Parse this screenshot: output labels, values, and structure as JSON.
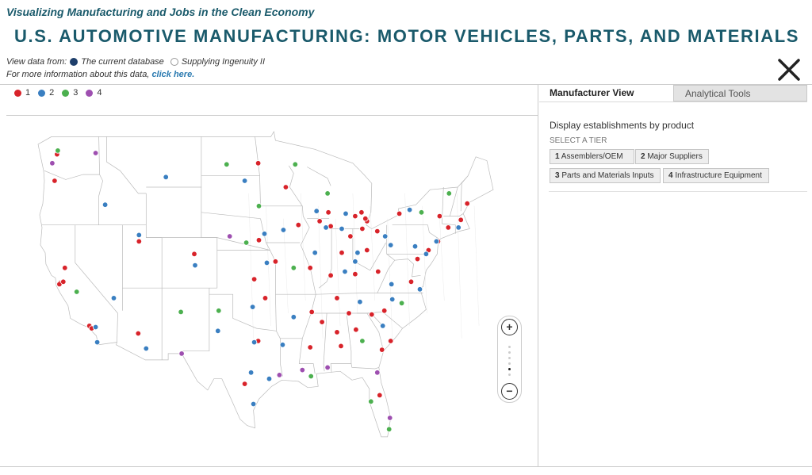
{
  "header": {
    "subtitle": "Visualizing Manufacturing and Jobs in the Clean Economy",
    "title": "U.S. AUTOMOTIVE MANUFACTURING: MOTOR VEHICLES, PARTS, AND MATERIALS"
  },
  "data_source": {
    "prefix": "View data from:",
    "options": [
      {
        "label": "The current database",
        "selected": true
      },
      {
        "label": "Supplying Ingenuity II",
        "selected": false
      }
    ],
    "info_text": "For more information about this data,",
    "info_link": "click here."
  },
  "close_icon": "close-x-icon",
  "legend": [
    {
      "label": "1",
      "color": "#d8232a"
    },
    {
      "label": "2",
      "color": "#3a7fc1"
    },
    {
      "label": "3",
      "color": "#4cb04f"
    },
    {
      "label": "4",
      "color": "#9e4fb0"
    }
  ],
  "tabs": [
    {
      "label": "Manufacturer View",
      "active": true
    },
    {
      "label": "Analytical Tools",
      "active": false
    }
  ],
  "panel": {
    "heading": "Display establishments by product",
    "tier_label": "SELECT A TIER",
    "tiers": [
      {
        "num": "1",
        "label": "Assemblers/OEM"
      },
      {
        "num": "2",
        "label": "Major Suppliers"
      },
      {
        "num": "3",
        "label": "Parts and Materials Inputs"
      },
      {
        "num": "4",
        "label": "Infrastructure Equipment"
      }
    ]
  },
  "zoom": {
    "in_label": "+",
    "out_label": "−",
    "level": 5,
    "levels": 6
  },
  "map": {
    "state_fill": "#ffffff",
    "state_stroke": "#bbbbbb",
    "markers": [
      {
        "lng": -122.6,
        "lat": 45.5,
        "tier": 1
      },
      {
        "lng": -122.3,
        "lat": 47.6,
        "tier": 1
      },
      {
        "lng": -122.2,
        "lat": 47.9,
        "tier": 3
      },
      {
        "lng": -122.9,
        "lat": 46.9,
        "tier": 4
      },
      {
        "lng": -117.4,
        "lat": 47.7,
        "tier": 4
      },
      {
        "lng": -116.2,
        "lat": 43.6,
        "tier": 2
      },
      {
        "lng": -121.9,
        "lat": 37.4,
        "tier": 1
      },
      {
        "lng": -122.0,
        "lat": 37.3,
        "tier": 1
      },
      {
        "lng": -121.5,
        "lat": 37.5,
        "tier": 1
      },
      {
        "lng": -121.3,
        "lat": 38.6,
        "tier": 1
      },
      {
        "lng": -119.8,
        "lat": 36.7,
        "tier": 3
      },
      {
        "lng": -118.2,
        "lat": 34.0,
        "tier": 1
      },
      {
        "lng": -117.9,
        "lat": 33.8,
        "tier": 1
      },
      {
        "lng": -117.4,
        "lat": 33.9,
        "tier": 2
      },
      {
        "lng": -117.2,
        "lat": 32.7,
        "tier": 2
      },
      {
        "lng": -115.1,
        "lat": 36.2,
        "tier": 2
      },
      {
        "lng": -111.9,
        "lat": 40.7,
        "tier": 1
      },
      {
        "lng": -111.9,
        "lat": 41.2,
        "tier": 2
      },
      {
        "lng": -112.0,
        "lat": 33.4,
        "tier": 1
      },
      {
        "lng": -111.0,
        "lat": 32.2,
        "tier": 2
      },
      {
        "lng": -104.9,
        "lat": 39.7,
        "tier": 1
      },
      {
        "lng": -104.8,
        "lat": 38.8,
        "tier": 2
      },
      {
        "lng": -106.6,
        "lat": 35.1,
        "tier": 3
      },
      {
        "lng": -106.5,
        "lat": 31.8,
        "tier": 4
      },
      {
        "lng": -108.5,
        "lat": 45.8,
        "tier": 2
      },
      {
        "lng": -100.8,
        "lat": 46.8,
        "tier": 3
      },
      {
        "lng": -96.8,
        "lat": 46.9,
        "tier": 1
      },
      {
        "lng": -98.5,
        "lat": 45.5,
        "tier": 2
      },
      {
        "lng": -96.7,
        "lat": 43.5,
        "tier": 3
      },
      {
        "lng": -96.0,
        "lat": 41.3,
        "tier": 2
      },
      {
        "lng": -96.7,
        "lat": 40.8,
        "tier": 1
      },
      {
        "lng": -98.3,
        "lat": 40.6,
        "tier": 3
      },
      {
        "lng": -100.4,
        "lat": 41.1,
        "tier": 4
      },
      {
        "lng": -97.3,
        "lat": 37.7,
        "tier": 1
      },
      {
        "lng": -95.7,
        "lat": 39.0,
        "tier": 2
      },
      {
        "lng": -94.6,
        "lat": 39.1,
        "tier": 1
      },
      {
        "lng": -97.5,
        "lat": 35.5,
        "tier": 2
      },
      {
        "lng": -95.9,
        "lat": 36.2,
        "tier": 1
      },
      {
        "lng": -96.8,
        "lat": 32.8,
        "tier": 1
      },
      {
        "lng": -97.3,
        "lat": 32.7,
        "tier": 2
      },
      {
        "lng": -97.7,
        "lat": 30.3,
        "tier": 2
      },
      {
        "lng": -98.5,
        "lat": 29.4,
        "tier": 1
      },
      {
        "lng": -95.4,
        "lat": 29.8,
        "tier": 2
      },
      {
        "lng": -94.1,
        "lat": 30.1,
        "tier": 4
      },
      {
        "lng": -101.8,
        "lat": 35.2,
        "tier": 3
      },
      {
        "lng": -101.9,
        "lat": 33.6,
        "tier": 2
      },
      {
        "lng": -97.4,
        "lat": 27.8,
        "tier": 2
      },
      {
        "lng": -93.3,
        "lat": 45.0,
        "tier": 1
      },
      {
        "lng": -92.1,
        "lat": 46.8,
        "tier": 3
      },
      {
        "lng": -93.6,
        "lat": 41.6,
        "tier": 2
      },
      {
        "lng": -91.7,
        "lat": 42.0,
        "tier": 1
      },
      {
        "lng": -90.2,
        "lat": 38.6,
        "tier": 1
      },
      {
        "lng": -92.3,
        "lat": 38.6,
        "tier": 3
      },
      {
        "lng": -92.3,
        "lat": 34.7,
        "tier": 2
      },
      {
        "lng": -91.2,
        "lat": 30.5,
        "tier": 4
      },
      {
        "lng": -90.1,
        "lat": 30.0,
        "tier": 3
      },
      {
        "lng": -93.7,
        "lat": 32.5,
        "tier": 2
      },
      {
        "lng": -87.9,
        "lat": 43.0,
        "tier": 1
      },
      {
        "lng": -89.4,
        "lat": 43.1,
        "tier": 2
      },
      {
        "lng": -88.0,
        "lat": 44.5,
        "tier": 3
      },
      {
        "lng": -87.6,
        "lat": 41.9,
        "tier": 1
      },
      {
        "lng": -88.2,
        "lat": 41.8,
        "tier": 2
      },
      {
        "lng": -89.6,
        "lat": 39.8,
        "tier": 2
      },
      {
        "lng": -89.0,
        "lat": 42.3,
        "tier": 1
      },
      {
        "lng": -83.0,
        "lat": 42.3,
        "tier": 1
      },
      {
        "lng": -83.2,
        "lat": 42.5,
        "tier": 1
      },
      {
        "lng": -84.5,
        "lat": 42.7,
        "tier": 1
      },
      {
        "lng": -85.7,
        "lat": 42.9,
        "tier": 2
      },
      {
        "lng": -83.7,
        "lat": 43.0,
        "tier": 1
      },
      {
        "lng": -86.2,
        "lat": 41.7,
        "tier": 2
      },
      {
        "lng": -85.1,
        "lat": 41.1,
        "tier": 1
      },
      {
        "lng": -86.2,
        "lat": 39.8,
        "tier": 1
      },
      {
        "lng": -87.6,
        "lat": 38.0,
        "tier": 1
      },
      {
        "lng": -85.8,
        "lat": 38.3,
        "tier": 2
      },
      {
        "lng": -84.5,
        "lat": 38.1,
        "tier": 1
      },
      {
        "lng": -84.5,
        "lat": 39.1,
        "tier": 2
      },
      {
        "lng": -83.0,
        "lat": 40.0,
        "tier": 1
      },
      {
        "lng": -81.7,
        "lat": 41.5,
        "tier": 1
      },
      {
        "lng": -83.6,
        "lat": 41.7,
        "tier": 1
      },
      {
        "lng": -80.7,
        "lat": 41.1,
        "tier": 2
      },
      {
        "lng": -84.2,
        "lat": 39.8,
        "tier": 2
      },
      {
        "lng": -80.0,
        "lat": 40.4,
        "tier": 2
      },
      {
        "lng": -76.9,
        "lat": 40.3,
        "tier": 2
      },
      {
        "lng": -75.2,
        "lat": 40.0,
        "tier": 1
      },
      {
        "lng": -78.9,
        "lat": 42.9,
        "tier": 1
      },
      {
        "lng": -77.6,
        "lat": 43.2,
        "tier": 2
      },
      {
        "lng": -76.1,
        "lat": 43.0,
        "tier": 3
      },
      {
        "lng": -73.8,
        "lat": 42.7,
        "tier": 1
      },
      {
        "lng": -74.0,
        "lat": 40.7,
        "tier": 1
      },
      {
        "lng": -74.2,
        "lat": 40.7,
        "tier": 2
      },
      {
        "lng": -72.7,
        "lat": 41.8,
        "tier": 1
      },
      {
        "lng": -71.1,
        "lat": 42.4,
        "tier": 1
      },
      {
        "lng": -71.4,
        "lat": 41.8,
        "tier": 2
      },
      {
        "lng": -72.6,
        "lat": 44.5,
        "tier": 3
      },
      {
        "lng": -70.3,
        "lat": 43.7,
        "tier": 1
      },
      {
        "lng": -76.6,
        "lat": 39.3,
        "tier": 1
      },
      {
        "lng": -75.5,
        "lat": 39.7,
        "tier": 2
      },
      {
        "lng": -77.4,
        "lat": 37.5,
        "tier": 1
      },
      {
        "lng": -76.3,
        "lat": 36.9,
        "tier": 2
      },
      {
        "lng": -79.9,
        "lat": 37.3,
        "tier": 2
      },
      {
        "lng": -81.6,
        "lat": 38.3,
        "tier": 1
      },
      {
        "lng": -80.8,
        "lat": 35.2,
        "tier": 1
      },
      {
        "lng": -79.8,
        "lat": 36.1,
        "tier": 2
      },
      {
        "lng": -78.6,
        "lat": 35.8,
        "tier": 3
      },
      {
        "lng": -82.4,
        "lat": 34.9,
        "tier": 1
      },
      {
        "lng": -81.0,
        "lat": 34.0,
        "tier": 2
      },
      {
        "lng": -80.0,
        "lat": 32.8,
        "tier": 1
      },
      {
        "lng": -84.4,
        "lat": 33.7,
        "tier": 1
      },
      {
        "lng": -83.6,
        "lat": 32.8,
        "tier": 3
      },
      {
        "lng": -81.1,
        "lat": 32.1,
        "tier": 1
      },
      {
        "lng": -86.8,
        "lat": 36.2,
        "tier": 1
      },
      {
        "lng": -85.3,
        "lat": 35.0,
        "tier": 1
      },
      {
        "lng": -83.9,
        "lat": 35.9,
        "tier": 2
      },
      {
        "lng": -90.0,
        "lat": 35.1,
        "tier": 1
      },
      {
        "lng": -86.8,
        "lat": 33.5,
        "tier": 1
      },
      {
        "lng": -86.3,
        "lat": 32.4,
        "tier": 1
      },
      {
        "lng": -88.0,
        "lat": 30.7,
        "tier": 4
      },
      {
        "lng": -90.2,
        "lat": 32.3,
        "tier": 1
      },
      {
        "lng": -88.7,
        "lat": 34.3,
        "tier": 1
      },
      {
        "lng": -81.7,
        "lat": 30.3,
        "tier": 4
      },
      {
        "lng": -81.4,
        "lat": 28.5,
        "tier": 1
      },
      {
        "lng": -82.5,
        "lat": 28.0,
        "tier": 3
      },
      {
        "lng": -80.2,
        "lat": 25.8,
        "tier": 3
      },
      {
        "lng": -80.1,
        "lat": 26.7,
        "tier": 4
      }
    ]
  }
}
